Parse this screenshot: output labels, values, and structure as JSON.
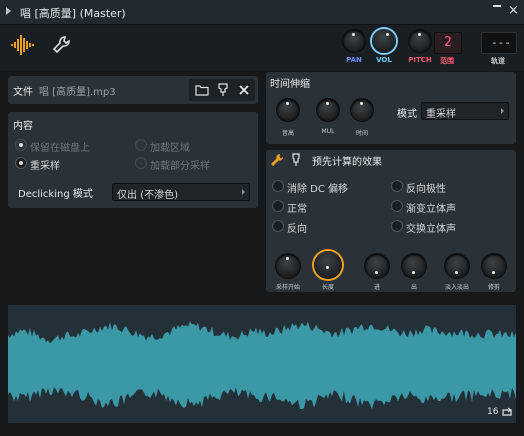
{
  "window": {
    "title": "唱 [高质量] (Master)",
    "minimize_glyph": "▬",
    "close_glyph": "×"
  },
  "toolbar": {
    "icons": [
      "waveform-icon",
      "wrench-icon"
    ],
    "knobs": {
      "pan": "PAN",
      "vol": "VOL",
      "pitch": "PITCH",
      "pitch_sub": "范围"
    },
    "pitch_range_value": "2",
    "tempo_value": "---",
    "tempo_label": "轨道",
    "colors": {
      "pan": "#6c8dff",
      "vol": "#7ad0ff",
      "pitch": "#ff5a72",
      "accent": "#f0a020"
    }
  },
  "file": {
    "label": "文件",
    "name": "唱 [高质量].mp3",
    "buttons": [
      "folder-icon",
      "pin-icon",
      "close-icon"
    ]
  },
  "content": {
    "title": "内容",
    "options": [
      {
        "label": "保留在磁盘上",
        "selected": true,
        "enabled": false
      },
      {
        "label": "加载区域",
        "selected": false,
        "enabled": false
      },
      {
        "label": "重采样",
        "selected": true,
        "enabled": true
      },
      {
        "label": "加载部分采样",
        "selected": false,
        "enabled": false
      }
    ],
    "declick_label": "Declicking 模式",
    "declick_value": "仅出 (不渗色)"
  },
  "timestretch": {
    "title": "时间伸缩",
    "knobs": [
      "音高",
      "MUL",
      "时间"
    ],
    "mode_label": "模式",
    "mode_value": "重采样"
  },
  "precomputed": {
    "title": "预先计算的效果",
    "options_left": [
      "消除 DC 偏移",
      "正常",
      "反向"
    ],
    "options_right": [
      "反向极性",
      "渐变立体声",
      "交换立体声"
    ],
    "knobs": [
      "采样开始",
      "长度",
      "进",
      "出",
      "淡入淡出",
      "修剪"
    ]
  },
  "waveform": {
    "count_label": "16",
    "loop_icon": "loop-icon",
    "color": "#3b98a6"
  }
}
